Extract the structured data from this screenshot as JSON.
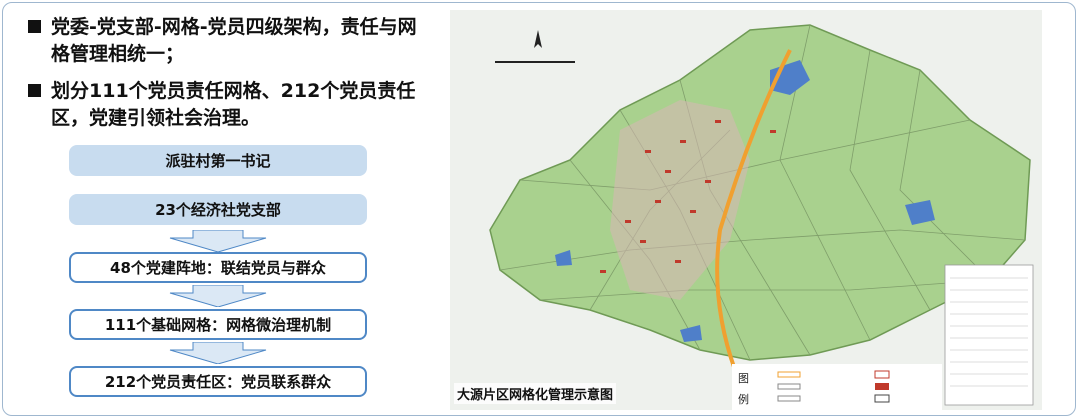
{
  "bullets": [
    "党委-党支部-网格-党员四级架构，责任与网格管理相统一；",
    "划分111个党员责任网格、212个党员责任区，党建引领社会治理。"
  ],
  "hierarchy": [
    "派驻村第一书记",
    "23个经济社党支部",
    "48个党建阵地：联结党员与群众",
    "111个基础网格：网格微治理机制",
    "212个党员责任区：党员联系群众"
  ],
  "map": {
    "title": "大源片区网格化管理示意图",
    "legend_heading": [
      "图",
      "例"
    ]
  },
  "colors": {
    "solid_box": "#c8dcef",
    "outline_border": "#4f88c6",
    "arrow_fill": "#dbe8f5"
  }
}
